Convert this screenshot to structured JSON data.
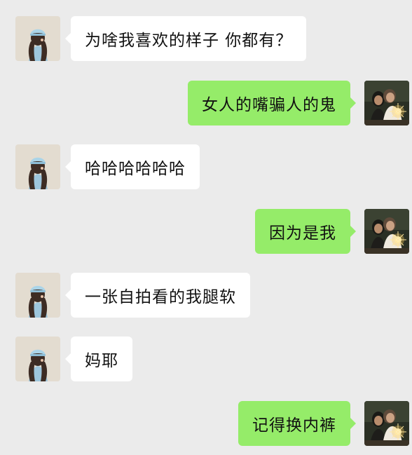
{
  "chat": {
    "messages": [
      {
        "side": "left",
        "text": "为啥我喜欢的样子 你都有？"
      },
      {
        "side": "right",
        "text": "女人的嘴骗人的鬼"
      },
      {
        "side": "left",
        "text": "哈哈哈哈哈哈"
      },
      {
        "side": "right",
        "text": "因为是我"
      },
      {
        "side": "left",
        "text": "一张自拍看的我腿软"
      },
      {
        "side": "left",
        "text": "妈耶"
      },
      {
        "side": "right",
        "text": "记得换内裤"
      }
    ]
  },
  "icons": {
    "contact_avatar": "girl-avatar-icon",
    "self_avatar": "sparkler-photo-avatar-icon"
  },
  "colors": {
    "background": "#ebebeb",
    "incoming_bubble": "#ffffff",
    "outgoing_bubble": "#95ec69"
  }
}
